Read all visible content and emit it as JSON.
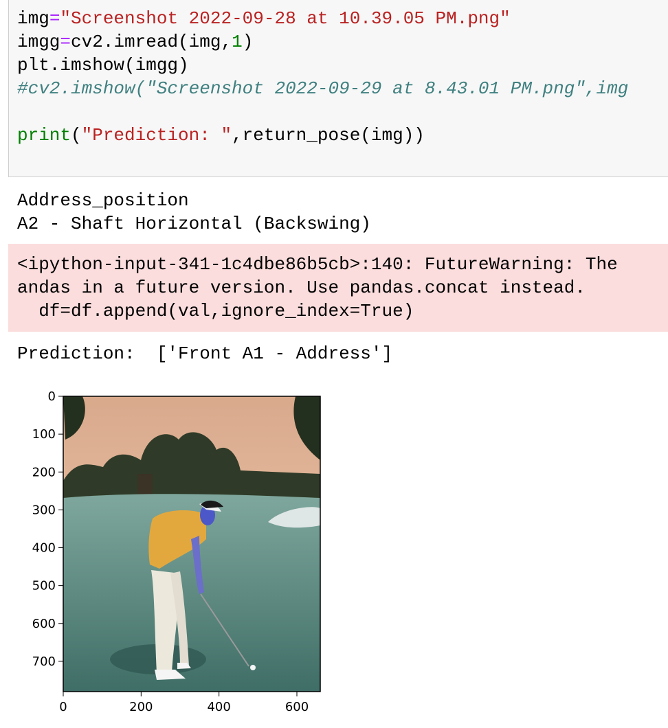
{
  "code_cell": {
    "line1": {
      "var": "img",
      "op": "=",
      "str": "\"Screenshot 2022-09-28 at 10.39.05 PM.png\""
    },
    "line2": {
      "var": "imgg",
      "op": "=",
      "call": "cv2.imread(img,",
      "num": "1",
      "close": ")"
    },
    "line3": "plt.imshow(imgg)",
    "line4": "#cv2.imshow(\"Screenshot 2022-09-29 at 8.43.01 PM.png\",img",
    "line6": {
      "fn": "print",
      "open": "(",
      "str": "\"Prediction: \"",
      "rest": ",return_pose(img))"
    }
  },
  "stdout1": [
    "Address_position",
    "A2 - Shaft Horizontal (Backswing)"
  ],
  "stderr": [
    "<ipython-input-341-1c4dbe86b5cb>:140: FutureWarning: The",
    "andas in a future version. Use pandas.concat instead.",
    "  df=df.append(val,ignore_index=True)"
  ],
  "stdout2": "Prediction:  ['Front A1 - Address']",
  "chart_data": {
    "type": "image",
    "x_ticks": [
      "0",
      "200",
      "400",
      "600"
    ],
    "y_ticks": [
      "0",
      "100",
      "200",
      "300",
      "400",
      "500",
      "600",
      "700"
    ],
    "xlim": [
      0,
      660
    ],
    "ylim": [
      780,
      0
    ]
  },
  "colors": {
    "string": "#ba2121",
    "operator": "#aa22ff",
    "number": "#008000",
    "comment": "#408080",
    "stderr_bg": "#fbdddd",
    "sky": "#e9bfa3",
    "grass": "#4f8178",
    "shirt": "#e3a83d"
  }
}
